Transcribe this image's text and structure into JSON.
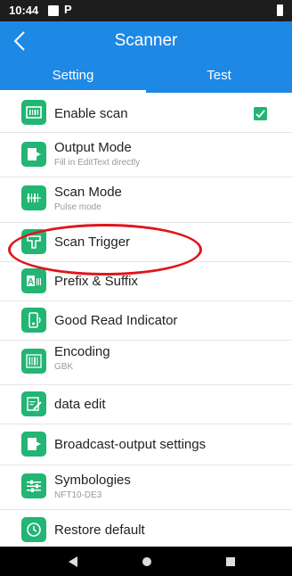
{
  "status_bar": {
    "time": "10:44",
    "p_icon": "P"
  },
  "app_bar": {
    "title": "Scanner"
  },
  "tabs": [
    {
      "label": "Setting",
      "active": true
    },
    {
      "label": "Test",
      "active": false
    }
  ],
  "settings": {
    "enable_scan": {
      "title": "Enable scan",
      "checked": true,
      "icon": "barcode-scan-icon"
    },
    "output_mode": {
      "title": "Output Mode",
      "subtitle": "Fill in EditText directly",
      "icon": "output-icon"
    },
    "scan_mode": {
      "title": "Scan Mode",
      "subtitle": "Pulse mode",
      "icon": "scan-mode-icon"
    },
    "scan_trigger": {
      "title": "Scan Trigger",
      "icon": "trigger-icon"
    },
    "prefix_suffix": {
      "title": "Prefix & Suffix",
      "icon": "prefix-suffix-icon"
    },
    "good_read": {
      "title": "Good Read Indicator",
      "icon": "good-read-icon"
    },
    "encoding": {
      "title": "Encoding",
      "subtitle": "GBK",
      "icon": "encoding-icon"
    },
    "data_edit": {
      "title": "data edit",
      "icon": "edit-icon"
    },
    "broadcast": {
      "title": "Broadcast-output settings",
      "icon": "broadcast-icon"
    },
    "symbologies": {
      "title": "Symbologies",
      "subtitle": "NFT10-DE3",
      "icon": "symbologies-icon"
    },
    "restore": {
      "title": "Restore default",
      "icon": "restore-icon"
    }
  },
  "colors": {
    "primary": "#1e88e5",
    "icon_green": "#22b573",
    "annotation_red": "#e0161b"
  }
}
